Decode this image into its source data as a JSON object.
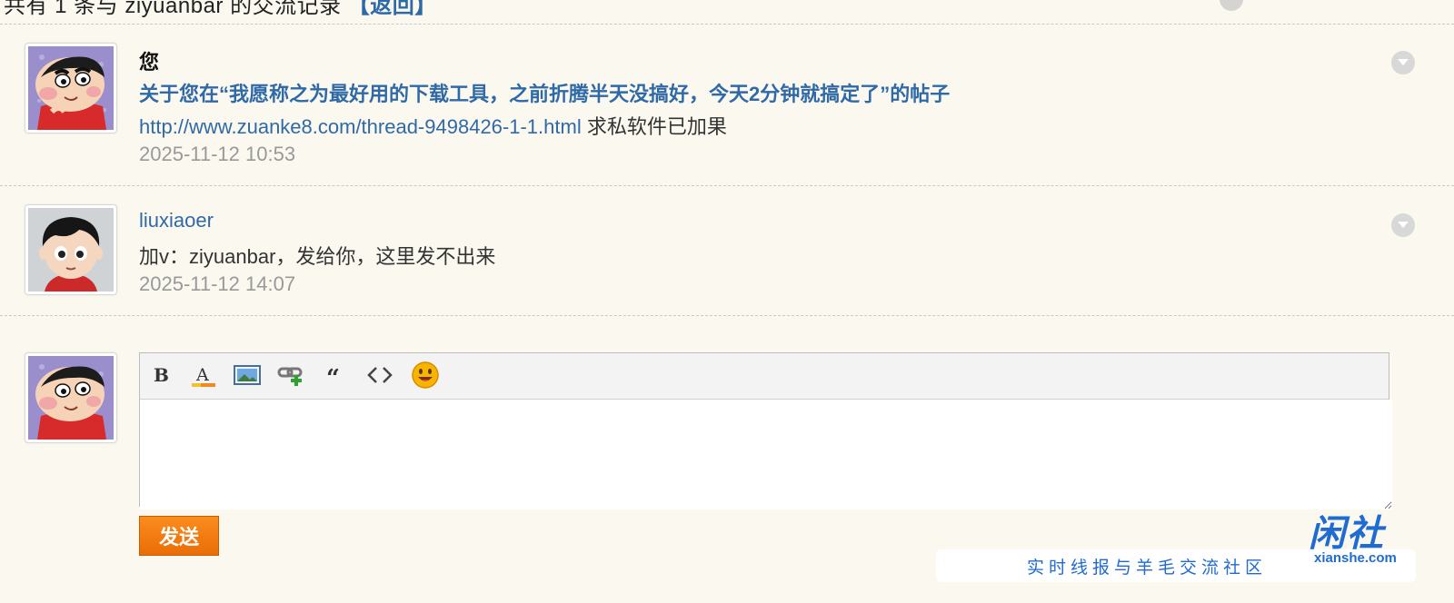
{
  "header": {
    "text_prefix": "共有 1 条与 ziyuanbar 的交流记录",
    "text_link": "【返回】"
  },
  "messages": [
    {
      "sender": "您",
      "subject": "关于您在“我愿称之为最好用的下载工具，之前折腾半天没搞好，今天2分钟就搞定了”的帖子",
      "url": "http://www.zuanke8.com/thread-9498426-1-1.html",
      "text": " 求私软件已加果",
      "time": "2025-11-12 10:53",
      "avatar_icon": "crayon-shinchan-avatar-icon"
    },
    {
      "sender": "liuxiaoer",
      "text": "加v：ziyuanbar，发给你，这里发不出来",
      "time": "2025-11-12 14:07",
      "avatar_icon": "cartoon-boy-avatar-icon"
    }
  ],
  "editor": {
    "toolbar": [
      "bold-icon",
      "font-color-icon",
      "image-icon",
      "link-icon",
      "quote-icon",
      "code-icon",
      "smiley-icon"
    ],
    "bold_glyph": "B",
    "font_color_glyph": "A",
    "quote_glyph": "“",
    "code_glyph": "<>",
    "send_label": "发送"
  },
  "watermark": {
    "logo_cn": "闲社",
    "logo_en": "xianshe.com",
    "slogan": "实时线报与羊毛交流社区"
  },
  "colors": {
    "background": "#fbf8ef",
    "link": "#2f6aa7",
    "send_button": "#f07a10",
    "watermark": "#1f6bd1"
  }
}
